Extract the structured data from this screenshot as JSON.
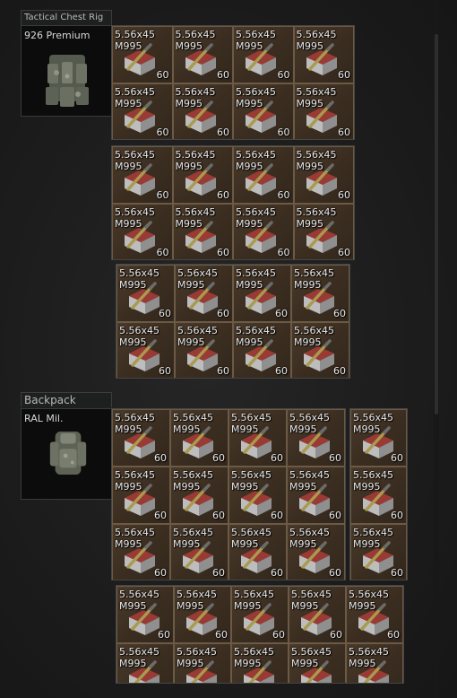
{
  "chest_rig": {
    "header": "Tactical Chest Rig",
    "item_name": "926 Premium",
    "grids": [
      {
        "rows": 2,
        "cols": 4
      },
      {
        "rows": 2,
        "cols": 4
      },
      {
        "rows": 2,
        "cols": 4
      }
    ]
  },
  "backpack": {
    "header": "Backpack",
    "item_name": "RAL Mil.",
    "grids": [
      {
        "rows": 3,
        "cols": 4
      },
      {
        "rows": 3,
        "cols": 1
      },
      {
        "rows": 2,
        "cols": 5
      }
    ]
  },
  "ammo": {
    "caliber": "5.56x45",
    "model": "M995",
    "count": "60"
  }
}
